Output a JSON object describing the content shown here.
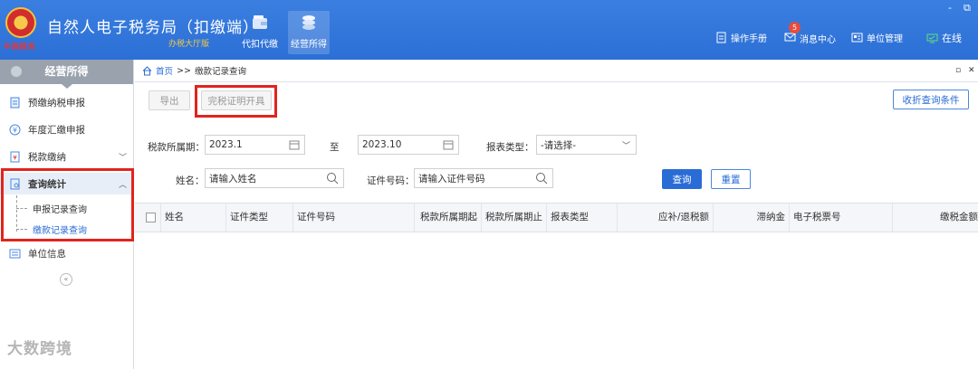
{
  "header": {
    "emblem_text": "中国税务",
    "title": "自然人电子税务局（扣缴端）",
    "subtitle": "办税大厅版",
    "tabs": [
      {
        "label": "代扣代缴",
        "icon": "wallet-icon"
      },
      {
        "label": "经营所得",
        "icon": "coins-icon"
      }
    ],
    "links": [
      {
        "label": "操作手册",
        "icon": "manual-icon"
      },
      {
        "label": "消息中心",
        "icon": "message-icon",
        "badge": "5"
      },
      {
        "label": "单位管理",
        "icon": "org-icon"
      },
      {
        "label": "在线",
        "icon": "monitor-icon"
      }
    ],
    "window_controls": {
      "minimize": "-",
      "restore": "⧉"
    }
  },
  "sidebar": {
    "title": "经营所得",
    "items": [
      {
        "label": "预缴纳税申报",
        "icon": "clipboard-icon"
      },
      {
        "label": "年度汇缴申报",
        "icon": "yen-circle-icon"
      },
      {
        "label": "税款缴纳",
        "icon": "invoice-icon",
        "chevron": "﹀"
      },
      {
        "label": "查询统计",
        "icon": "report-icon",
        "chevron": "︿"
      },
      {
        "label": "单位信息",
        "icon": "list-icon"
      }
    ],
    "sub_items": [
      "申报记录查询",
      "缴款记录查询"
    ],
    "collapse": "«",
    "watermark": "大数跨境"
  },
  "main": {
    "breadcrumb": {
      "home": "首页",
      "sep": ">>",
      "current": "缴款记录查询"
    },
    "bc_controls": {
      "restore": "▫",
      "close": "✕"
    },
    "toolbar": {
      "export": "导出",
      "certificate": "完税证明开具",
      "collapse_query": "收折查询条件"
    },
    "form": {
      "period_label": "税款所属期：",
      "period_from": "2023.1",
      "period_to_label": "至",
      "period_to": "2023.10",
      "report_type_label": "报表类型：",
      "report_type_value": "-请选择-",
      "name_label": "姓名：",
      "name_placeholder": "请输入姓名",
      "id_label": "证件号码：",
      "id_placeholder": "请输入证件号码",
      "query_button": "查询",
      "reset_button": "重置"
    },
    "table": {
      "columns": [
        "姓名",
        "证件类型",
        "证件号码",
        "税款所属期起",
        "税款所属期止",
        "报表类型",
        "应补/退税额",
        "滞纳金",
        "电子税票号",
        "缴税金额"
      ]
    }
  },
  "colors": {
    "header": "#2c6fd6",
    "accent": "#2a6cd6",
    "highlight_box": "#e0241d"
  }
}
